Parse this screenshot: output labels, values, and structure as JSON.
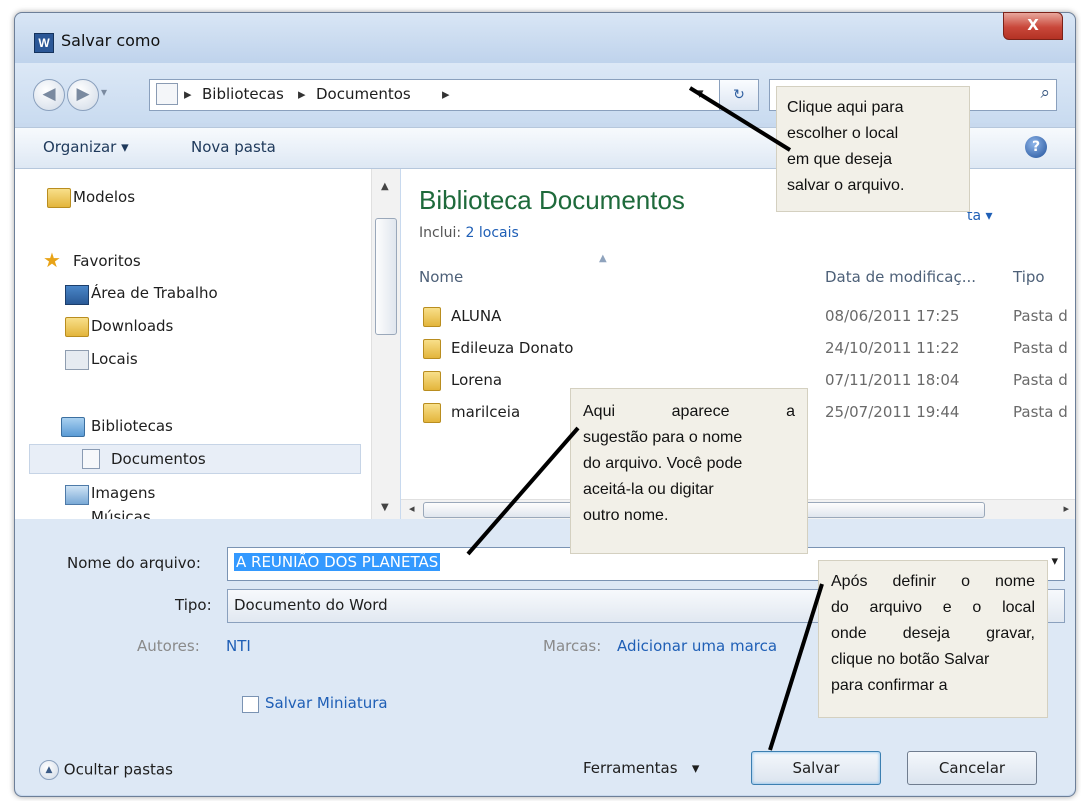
{
  "window": {
    "app_icon": "W",
    "title": "Salvar como",
    "close": "X"
  },
  "nav": {
    "back": "◀",
    "forward": "▶",
    "path": [
      "Bibliotecas",
      "Documentos"
    ],
    "search_placeholder": "P"
  },
  "toolbar": {
    "organize": "Organizar",
    "new_folder": "Nova pasta",
    "help": "?"
  },
  "sidebar": {
    "items": [
      {
        "label": "Modelos",
        "icon": "folder-icon"
      },
      {
        "label": "Favoritos",
        "icon": "star-icon"
      },
      {
        "label": "Área de Trabalho",
        "icon": "desktop-icon"
      },
      {
        "label": "Downloads",
        "icon": "downloads-folder-icon"
      },
      {
        "label": "Locais",
        "icon": "recent-places-icon"
      },
      {
        "label": "Bibliotecas",
        "icon": "libraries-icon"
      },
      {
        "label": "Documentos",
        "icon": "documents-icon",
        "selected": true
      },
      {
        "label": "Imagens",
        "icon": "pictures-icon"
      },
      {
        "label": "Músicas",
        "icon": "music-icon"
      }
    ]
  },
  "library": {
    "title": "Biblioteca Documentos",
    "includes_label": "Inclui:",
    "includes_link": "2 locais",
    "arrange_fragment": "ta"
  },
  "columns": {
    "name": "Nome",
    "date": "Data de modificaç...",
    "type": "Tipo"
  },
  "files": [
    {
      "name": "ALUNA",
      "date": "08/06/2011 17:25",
      "type": "Pasta d"
    },
    {
      "name": "Edileuza Donato",
      "date": "24/10/2011 11:22",
      "type": "Pasta d"
    },
    {
      "name": "Lorena",
      "date": "07/11/2011 18:04",
      "type": "Pasta d"
    },
    {
      "name": "marilceia",
      "date": "25/07/2011 19:44",
      "type": "Pasta d"
    }
  ],
  "form": {
    "filename_label": "Nome do arquivo:",
    "filename_value": "A REUNIÃO DOS PLANETAS",
    "type_label": "Tipo:",
    "type_value": "Documento do Word",
    "authors_label": "Autores:",
    "authors_value": "NTI",
    "tags_label": "Marcas:",
    "tags_value": "Adicionar uma marca",
    "thumbnail_label": "Salvar Miniatura"
  },
  "footer": {
    "hide_folders": "Ocultar pastas",
    "tools": "Ferramentas",
    "save": "Salvar",
    "cancel": "Cancelar"
  },
  "callouts": {
    "location": [
      "Clique aqui para",
      "escolher o local",
      "em que deseja",
      "salvar o arquivo."
    ],
    "filename": [
      "Aqui aparece a",
      "sugestão para o nome",
      "do arquivo. Você pode",
      "aceitá-la ou digitar",
      "outro nome."
    ],
    "save": [
      "Após definir o nome",
      "do arquivo e o local",
      "onde deseja gravar,",
      "clique no botão Salvar",
      "para confirmar a"
    ]
  }
}
